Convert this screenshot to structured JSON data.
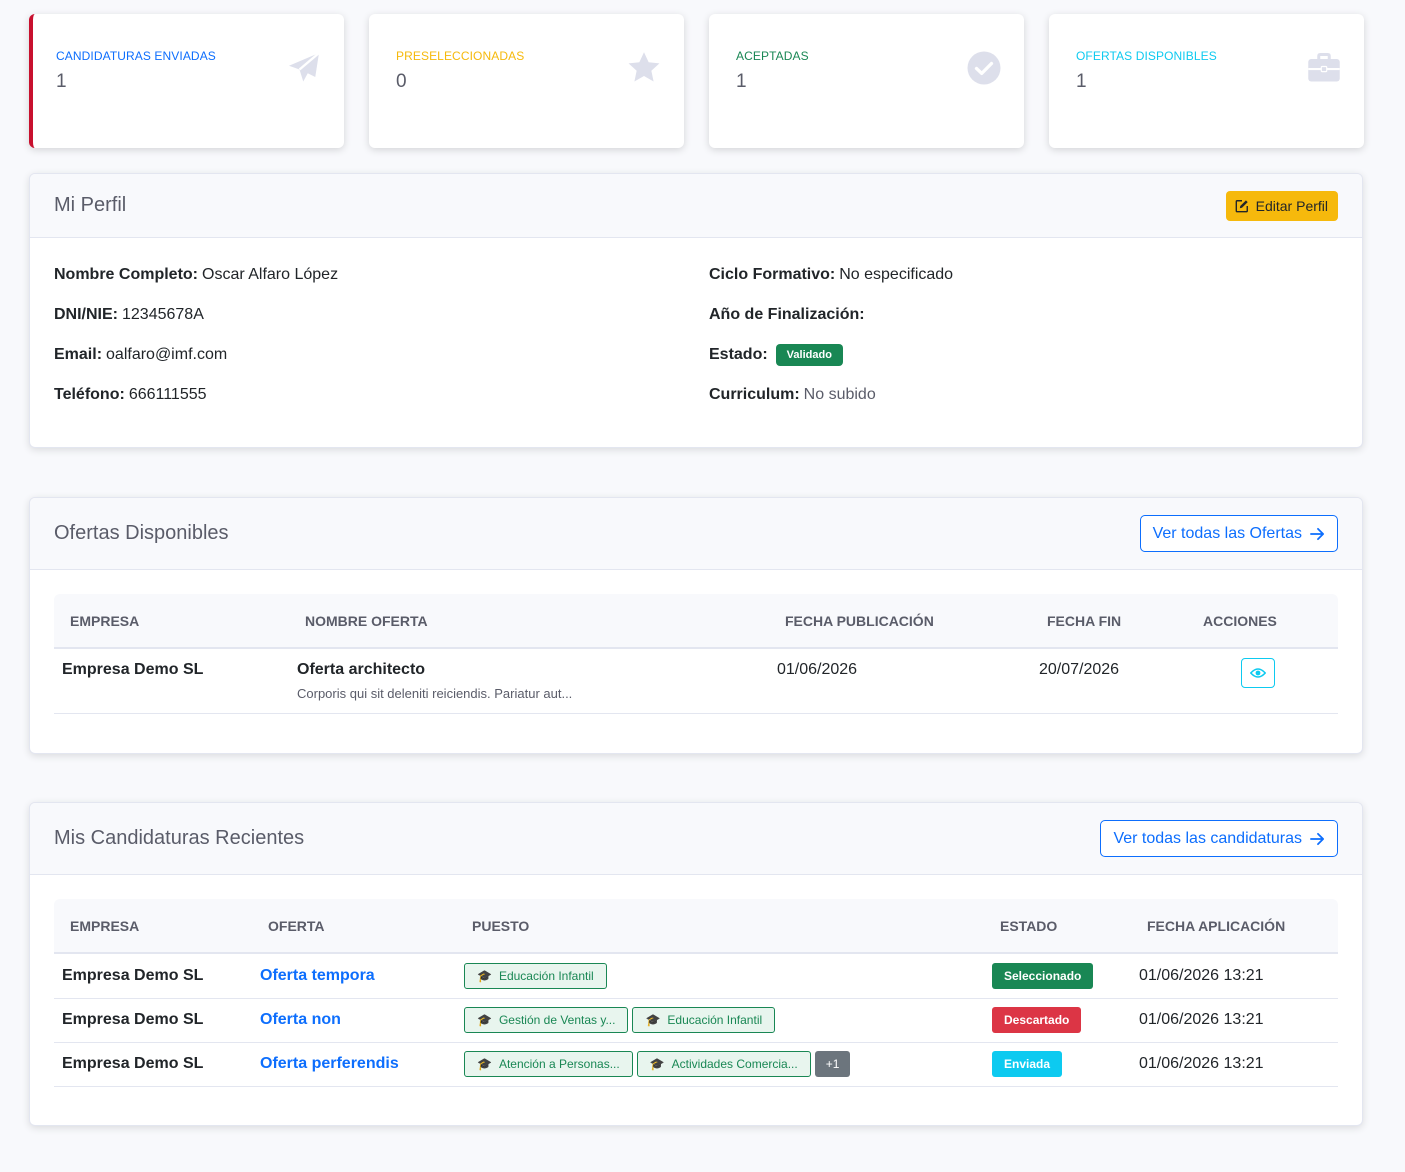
{
  "stats": [
    {
      "label": "CANDIDATURAS ENVIADAS",
      "value": "1",
      "color": "#0d6efd",
      "icon": "paper-plane-icon"
    },
    {
      "label": "PRESELECCIONADAS",
      "value": "0",
      "color": "#f6b90c",
      "icon": "star-icon"
    },
    {
      "label": "ACEPTADAS",
      "value": "1",
      "color": "#198754",
      "icon": "check-circle-icon"
    },
    {
      "label": "OFERTAS DISPONIBLES",
      "value": "1",
      "color": "#0dcaf0",
      "icon": "briefcase-icon"
    }
  ],
  "profile": {
    "title": "Mi Perfil",
    "edit_label": "Editar Perfil",
    "left": [
      {
        "label": "Nombre Completo:",
        "value": "Oscar Alfaro López"
      },
      {
        "label": "DNI/NIE:",
        "value": "12345678A"
      },
      {
        "label": "Email:",
        "value": "oalfaro@imf.com"
      },
      {
        "label": "Teléfono:",
        "value": "666111555"
      }
    ],
    "ciclo": {
      "label": "Ciclo Formativo:",
      "value": "No especificado"
    },
    "anio": {
      "label": "Año de Finalización:",
      "value": ""
    },
    "estado": {
      "label": "Estado:",
      "value": "Validado"
    },
    "curriculum": {
      "label": "Curriculum:",
      "value": "No subido"
    }
  },
  "offers": {
    "title": "Ofertas Disponibles",
    "view_all_label": "Ver todas las Ofertas",
    "columns": [
      "EMPRESA",
      "NOMBRE OFERTA",
      "FECHA PUBLICACIÓN",
      "FECHA FIN",
      "ACCIONES"
    ],
    "rows": [
      {
        "empresa": "Empresa Demo SL",
        "nombre": "Oferta architecto",
        "descripcion": "Corporis qui sit deleniti reiciendis. Pariatur aut...",
        "publicacion": "01/06/2026",
        "fin": "20/07/2026"
      }
    ]
  },
  "applications": {
    "title": "Mis Candidaturas Recientes",
    "view_all_label": "Ver todas las candidaturas",
    "columns": [
      "EMPRESA",
      "OFERTA",
      "PUESTO",
      "ESTADO",
      "FECHA APLICACIÓN"
    ],
    "rows": [
      {
        "empresa": "Empresa Demo SL",
        "oferta": "Oferta tempora",
        "puestos": [
          "Educación Infantil"
        ],
        "extra": "",
        "estado": "Seleccionado",
        "estado_color": "#198754",
        "fecha": "01/06/2026 13:21"
      },
      {
        "empresa": "Empresa Demo SL",
        "oferta": "Oferta non",
        "puestos": [
          "Gestión de Ventas y...",
          "Educación Infantil"
        ],
        "extra": "",
        "estado": "Descartado",
        "estado_color": "#dc3545",
        "fecha": "01/06/2026 13:21"
      },
      {
        "empresa": "Empresa Demo SL",
        "oferta": "Oferta perferendis",
        "puestos": [
          "Atención a Personas...",
          "Actividades Comercia..."
        ],
        "extra": "+1",
        "estado": "Enviada",
        "estado_color": "#0dcaf0",
        "fecha": "01/06/2026 13:21"
      }
    ]
  }
}
